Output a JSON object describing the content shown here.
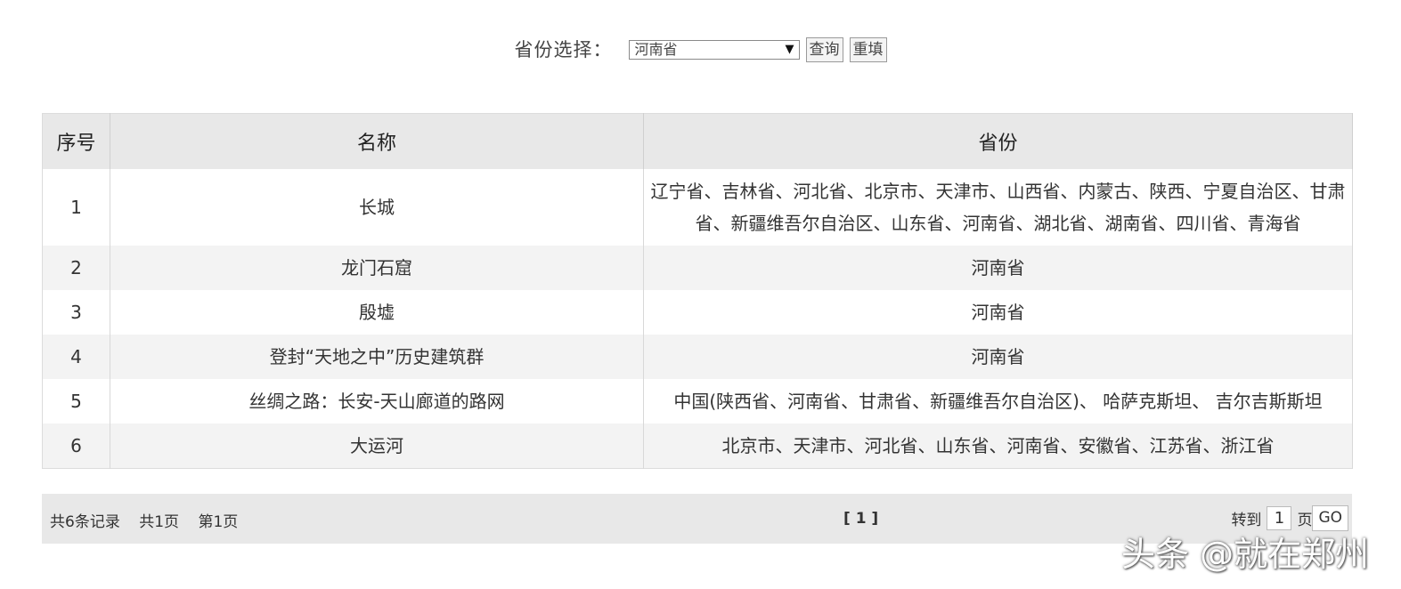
{
  "filter": {
    "label": "省份选择：",
    "selected": "河南省",
    "arrow": "▼",
    "query_button": "查询",
    "reset_button": "重填"
  },
  "table": {
    "headers": [
      "序号",
      "名称",
      "省份"
    ],
    "rows": [
      {
        "index": "1",
        "name": "长城",
        "province": "辽宁省、吉林省、河北省、北京市、天津市、山西省、内蒙古、陕西、宁夏自治区、甘肃省、新疆维吾尔自治区、山东省、河南省、湖北省、湖南省、四川省、青海省"
      },
      {
        "index": "2",
        "name": "龙门石窟",
        "province": "河南省"
      },
      {
        "index": "3",
        "name": "殷墟",
        "province": "河南省"
      },
      {
        "index": "4",
        "name": "登封“天地之中”历史建筑群",
        "province": "河南省"
      },
      {
        "index": "5",
        "name": "丝绸之路：长安-天山廊道的路网",
        "province": "中国(陕西省、河南省、甘肃省、新疆维吾尔自治区)、 哈萨克斯坦、 吉尔吉斯斯坦"
      },
      {
        "index": "6",
        "name": "大运河",
        "province": "北京市、天津市、河北省、山东省、河南省、安徽省、江苏省、浙江省"
      }
    ]
  },
  "pager": {
    "total_records": "共6条记录",
    "total_pages": "共1页",
    "current_page_text": "第1页",
    "current_marker": "[ 1 ]",
    "goto_label": "转到",
    "page_input": "1",
    "page_unit": "页",
    "go_button": "GO"
  },
  "watermark": "头条 @就在郑州"
}
